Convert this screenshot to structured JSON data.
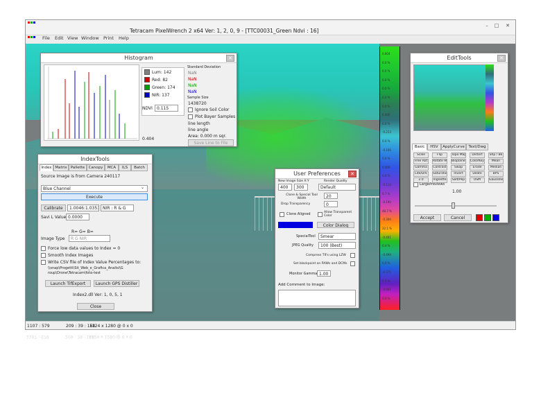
{
  "app_title": "Tetracam PixelWrench 2 x64   Ver: 1, 2, 0, 9 - [TTC00031_Green Ndvi : 16]",
  "menu": [
    "File",
    "Edit",
    "View",
    "Window",
    "Print",
    "Help"
  ],
  "window_controls": {
    "minimize": "–",
    "maximize": "□",
    "close": "✕"
  },
  "status": {
    "coords": "1107 : 579",
    "rgb": "209 : 39 : 168",
    "size": "1124 x 1280 @ 0 x 0"
  },
  "reflection_status": {
    "coords": "1107 : 579",
    "rgb": "209 : 39 : 168",
    "size": "1124 x 1280 @ 0 x 0"
  },
  "histogram": {
    "title": "Histogram",
    "channels": [
      {
        "label": "Lum: 142",
        "color": "#808080",
        "std": "NaN"
      },
      {
        "label": "Red: 82",
        "color": "#d00000",
        "std": "NaN"
      },
      {
        "label": "Green: 174",
        "color": "#00a000",
        "std": "NaN"
      },
      {
        "label": "NIR: 137",
        "color": "#0000c0",
        "std": "NaN"
      }
    ],
    "std_label": "Standard Deviation",
    "sample_label": "Sample Size",
    "sample_value": "1438720",
    "ndvi_label": "NDVI",
    "ndvi_value": "0.115",
    "axis_value": "0.404",
    "ignore_soil": "Ignore Soil Color",
    "plot_bayer": "Plot Bayer Samples",
    "line_length": "line length",
    "line_angle": "line angle",
    "area": "Area: 0.000 m sqr.",
    "save_line": "Save Line to File"
  },
  "index_tools": {
    "title": "IndexTools",
    "tabs": [
      "Index",
      "Matrix",
      "Pallette",
      "Canopy",
      "MCA",
      "ILS",
      "Batch"
    ],
    "source": "Source Image is from Camera 240117",
    "channel": "Blue Channel",
    "execute": "Execute",
    "calibrate": "Calibrate",
    "calibrate_value": "1.0046:1.0353",
    "nir_select": "NIR : R & G",
    "savi_label": "Savi L Value",
    "savi_value": "0.0000",
    "rgb_labels": "R=    G=    B=",
    "image_type_label": "Image Type",
    "image_type_values": "R   G   NIR",
    "force_low": "Force low data values to Index = 0",
    "smooth": "Smooth Index Images",
    "write_csv": "Write CSV file of Index Value Percentages to:",
    "csv_path": "\\\\snap\\Progetti\\Sit_Web_e_Grafica_Analisi\\Group\\Drone\\Tetracam\\foto-test",
    "launch_tif": "Launch TifExport",
    "launch_gps": "Launch GPS Distiller",
    "dll": "Index2.dll  Ver: 1, 0, 5, 1",
    "close": "Close"
  },
  "prefs": {
    "title": "User Preferences",
    "image_size_label": "New Image Size X:Y",
    "size_x": "400",
    "size_y": "300",
    "render_label": "Render Quality",
    "render_value": "Default",
    "clone_label": "Clone & Special Tool Width",
    "clone_value": "20",
    "drop_label": "Drop Transparency",
    "drop_value": "0",
    "clone_aligned": "Clone Aligned",
    "allow_transparent": "Allow Transparent Color",
    "color_dialog": "Color Dialog",
    "special_label": "SpecialTool",
    "special_value": "Smear",
    "jpeg_label": "JPEG Quality",
    "jpeg_value": "100 (Best)",
    "compress": "Compress TIFs using LZW",
    "set_black": "Set blackpoint on RAWs and DCMs",
    "gamma_label": "Monitor Gamma",
    "gamma_value": "1.00",
    "comment_label": "Add Comment to Image:",
    "accent": "#0000e0"
  },
  "edit_tools": {
    "title": "EditTools",
    "tabs": [
      "Basic",
      "HSV",
      "ApplyCurve",
      "Text/Dwg"
    ],
    "buttons": [
      "Scale",
      "Flip",
      "Topo Map",
      "Distort",
      "Shp / Bk",
      "Free Rot",
      "Rotate 90",
      "Bioplanes",
      "ColorKey",
      "Mean",
      "Gamma",
      "Contrast",
      "Swap",
      "Erode",
      "Median",
      "Lite/Drk",
      "Saturation",
      "Invert",
      "Dilate",
      "BPS",
      "2.0",
      "Vignette",
      "Salt/Pep",
      "USM",
      "Gaussdist"
    ],
    "large_previews": "LargePreviews",
    "slider_value": "1.00",
    "slider_level": 0.47,
    "accept": "Accept",
    "cancel": "Cancel"
  },
  "palette_values": [
    "0.804",
    "0.0 %",
    "0.0 %",
    "0.0 %",
    "0.0 %",
    "0.0 %",
    "0.0 %",
    "0.000",
    "0.0 %",
    "-0.213",
    "0.0 %",
    "-0.106",
    "0.0 %",
    "0.009",
    "0.0 %",
    "-0.114",
    "0.7 %",
    "-0.190",
    "48.7 %",
    "-0.300",
    "22.1 %",
    "-0.401",
    "0.4 %",
    "-0.499",
    "0.0 %",
    "-0.575",
    "0.0 %",
    "-0.601",
    "0.0 %"
  ]
}
